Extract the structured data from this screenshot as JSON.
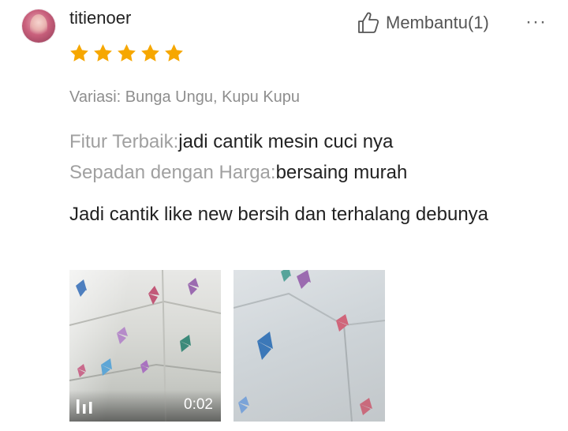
{
  "review": {
    "username": "titienoer",
    "rating": 5,
    "rating_max": 5,
    "helpful_label": "Membantu(1)",
    "more_label": "···",
    "variation": "Variasi: Bunga Ungu, Kupu Kupu",
    "attributes": [
      {
        "key": "Fitur Terbaik:",
        "value": "jadi cantik mesin cuci nya"
      },
      {
        "key": "Sepadan dengan Harga:",
        "value": "bersaing murah"
      }
    ],
    "text": "Jadi cantik like new bersih dan terhalang debunya",
    "media": [
      {
        "type": "video",
        "duration": "0:02"
      },
      {
        "type": "image"
      }
    ]
  },
  "colors": {
    "star": "#f6a700",
    "muted_text": "#a0a0a0",
    "body_text": "#222222"
  },
  "icons": {
    "helpful": "thumbs-up-icon",
    "more": "more-icon",
    "video": "video-bars-icon"
  }
}
